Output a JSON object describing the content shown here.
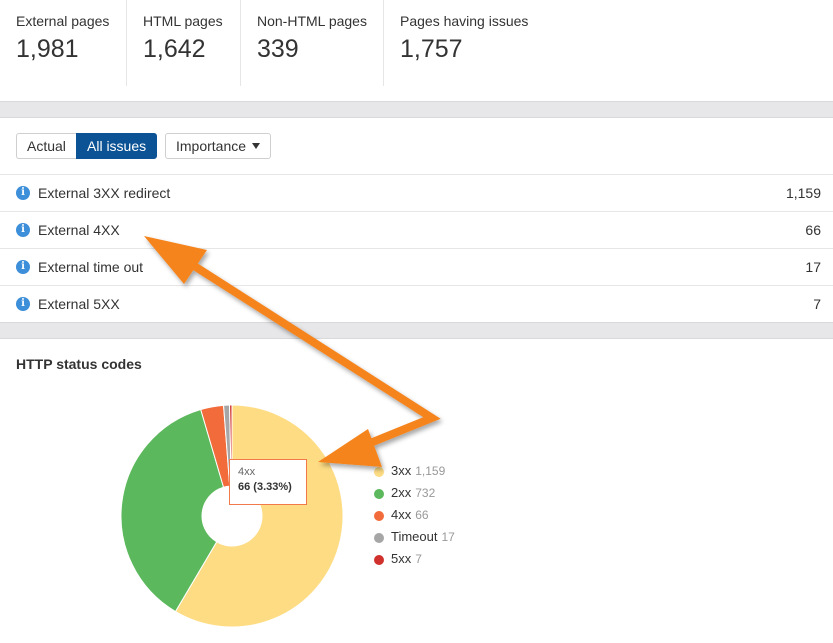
{
  "stats": [
    {
      "label": "External pages",
      "value": "1,981"
    },
    {
      "label": "HTML pages",
      "value": "1,642"
    },
    {
      "label": "Non-HTML pages",
      "value": "339"
    },
    {
      "label": "Pages having issues",
      "value": "1,757"
    }
  ],
  "toolbar": {
    "actual_label": "Actual",
    "all_issues_label": "All issues",
    "importance_label": "Importance"
  },
  "issues": [
    {
      "label": "External 3XX redirect",
      "count": "1,159"
    },
    {
      "label": "External 4XX",
      "count": "66"
    },
    {
      "label": "External time out",
      "count": "17"
    },
    {
      "label": "External 5XX",
      "count": "7"
    }
  ],
  "http_section": {
    "title": "HTTP status codes"
  },
  "tooltip": {
    "label": "4xx",
    "value": "66 (3.33%)"
  },
  "colors": {
    "accent": "#0b5394",
    "info_icon": "#3d8fd9",
    "arrow": "#f5841f"
  },
  "chart_data": {
    "type": "pie",
    "donut": true,
    "slices": [
      {
        "label": "3xx",
        "value": 1159,
        "color": "#fddc84"
      },
      {
        "label": "2xx",
        "value": 732,
        "color": "#5cb85c"
      },
      {
        "label": "4xx",
        "value": 66,
        "color": "#f26b3a"
      },
      {
        "label": "Timeout",
        "value": 17,
        "color": "#a6a6a6"
      },
      {
        "label": "5xx",
        "value": 7,
        "color": "#d0312d"
      }
    ],
    "legend": [
      {
        "label": "3xx",
        "count": "1,159",
        "color": "#fddc84"
      },
      {
        "label": "2xx",
        "count": "732",
        "color": "#5cb85c"
      },
      {
        "label": "4xx",
        "count": "66",
        "color": "#f26b3a"
      },
      {
        "label": "Timeout",
        "count": "17",
        "color": "#a6a6a6"
      },
      {
        "label": "5xx",
        "count": "7",
        "color": "#d0312d"
      }
    ],
    "legend_position": "right"
  }
}
